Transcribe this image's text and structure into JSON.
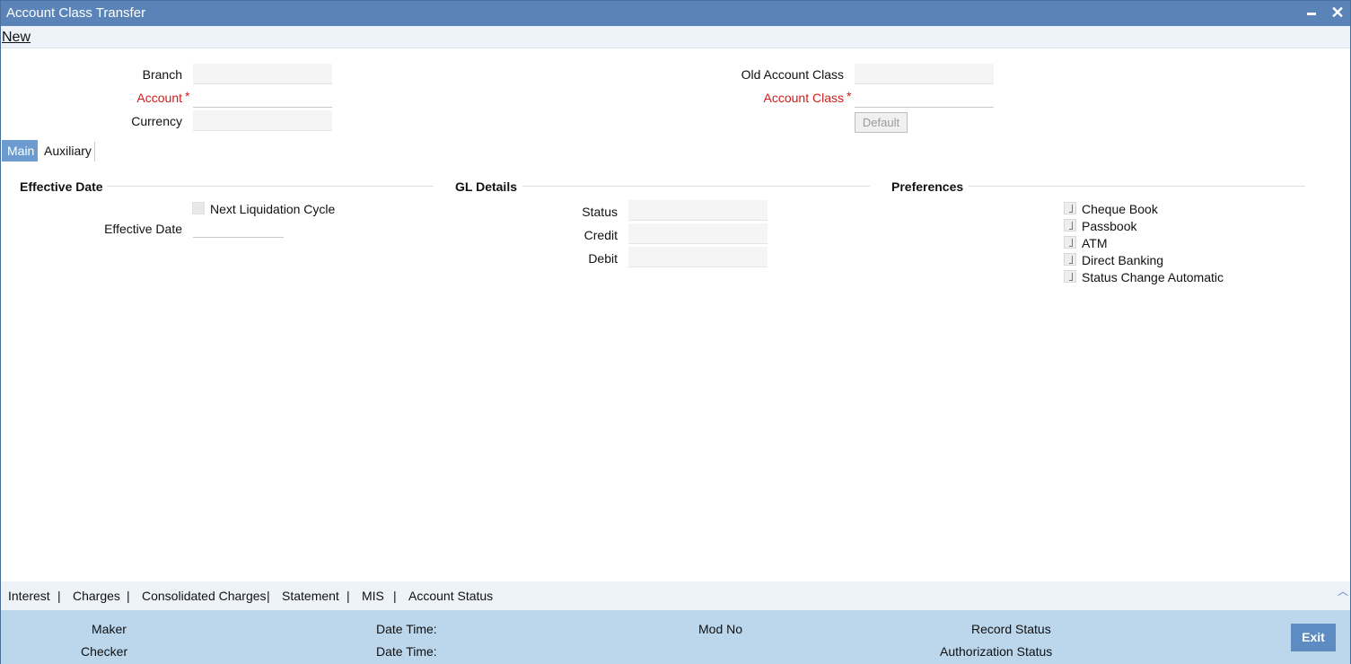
{
  "window": {
    "title": "Account Class Transfer"
  },
  "menu": {
    "new_label": "New"
  },
  "header_fields": {
    "branch_label": "Branch",
    "account_label": "Account",
    "currency_label": "Currency",
    "old_account_class_label": "Old Account Class",
    "account_class_label": "Account Class",
    "default_button": "Default",
    "required_mark": "*"
  },
  "tabs": [
    {
      "label": "Main",
      "active": true
    },
    {
      "label": "Auxiliary",
      "active": false
    }
  ],
  "effective_date_section": {
    "title": "Effective Date",
    "next_liquidation_label": "Next Liquidation Cycle",
    "effective_date_label": "Effective Date"
  },
  "gl_details_section": {
    "title": "GL Details",
    "status_label": "Status",
    "credit_label": "Credit",
    "debit_label": "Debit"
  },
  "preferences_section": {
    "title": "Preferences",
    "items": [
      "Cheque Book",
      "Passbook",
      "ATM",
      "Direct Banking",
      "Status Change Automatic"
    ]
  },
  "subnav": {
    "items": [
      "Interest",
      "Charges",
      "Consolidated Charges",
      "Statement",
      "MIS",
      "Account Status"
    ],
    "separator": "|"
  },
  "footer": {
    "maker_label": "Maker",
    "checker_label": "Checker",
    "date_time_label": "Date Time:",
    "mod_no_label": "Mod No",
    "record_status_label": "Record Status",
    "authorization_status_label": "Authorization Status",
    "exit_label": "Exit"
  },
  "colors": {
    "titlebar": "#5a84b8",
    "active_tab": "#6c9bd0",
    "required": "#d21b1b",
    "footer": "#bcd6ec",
    "exit_button": "#5c8cc2"
  }
}
